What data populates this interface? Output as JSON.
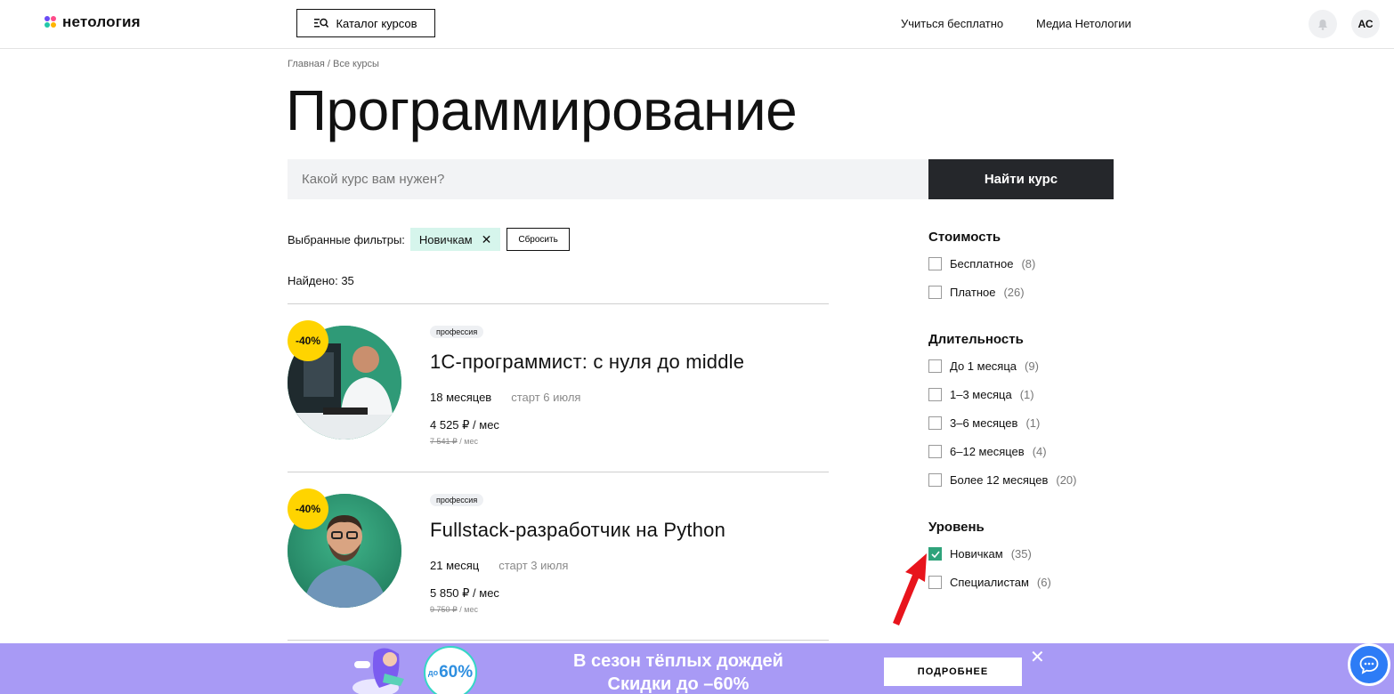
{
  "header": {
    "logo_text": "нетология",
    "catalog_label": "Каталог курсов",
    "nav": [
      "Учиться бесплатно",
      "Медиа Нетологии"
    ],
    "avatar_initials": "АС"
  },
  "breadcrumb": {
    "home": "Главная",
    "separator": " / ",
    "current": "Все курсы"
  },
  "page_title": "Программирование",
  "search": {
    "placeholder": "Какой курс вам нужен?",
    "button": "Найти курс"
  },
  "filters": {
    "label": "Выбранные фильтры:",
    "chip": "Новичкам",
    "reset": "Сбросить"
  },
  "found": "Найдено: 35",
  "courses": [
    {
      "discount": "-40%",
      "tag": "профессия",
      "title": "1С-программист: с нуля до middle",
      "duration": "18 месяцев",
      "start": "старт 6 июля",
      "price": "4 525 ₽  / мес",
      "old_price": "7 541 ₽",
      "old_price_unit": " / мес"
    },
    {
      "discount": "-40%",
      "tag": "профессия",
      "title": "Fullstack-разработчик на Python",
      "duration": "21 месяц",
      "start": "старт 3 июля",
      "price": "5 850 ₽  / мес",
      "old_price": "9 750 ₽",
      "old_price_unit": " / мес"
    }
  ],
  "sidebar": {
    "cost": {
      "title": "Стоимость",
      "items": [
        {
          "label": "Бесплатное",
          "count": "(8)",
          "checked": false
        },
        {
          "label": "Платное",
          "count": "(26)",
          "checked": false
        }
      ]
    },
    "duration": {
      "title": "Длительность",
      "items": [
        {
          "label": "До 1 месяца",
          "count": "(9)",
          "checked": false
        },
        {
          "label": "1–3 месяца",
          "count": "(1)",
          "checked": false
        },
        {
          "label": "3–6 месяцев",
          "count": "(1)",
          "checked": false
        },
        {
          "label": "6–12 месяцев",
          "count": "(4)",
          "checked": false
        },
        {
          "label": "Более 12 месяцев",
          "count": "(20)",
          "checked": false
        }
      ]
    },
    "level": {
      "title": "Уровень",
      "items": [
        {
          "label": "Новичкам",
          "count": "(35)",
          "checked": true
        },
        {
          "label": "Специалистам",
          "count": "(6)",
          "checked": false
        }
      ]
    }
  },
  "promo": {
    "line1": "В сезон тёплых дождей",
    "line2": "Скидки до –60%",
    "badge_prefix": "до",
    "badge_value": "60%",
    "button": "ПОДРОБНЕЕ",
    "close": "✕"
  },
  "colors": {
    "accent_dark": "#25272b",
    "chip_bg": "#d6f5ec",
    "discount_yellow": "#ffd400",
    "checkbox_green": "#2fa37b",
    "promo_purple": "#a89af5",
    "chat_blue": "#2d7cf6",
    "arrow_red": "#e8141c"
  }
}
